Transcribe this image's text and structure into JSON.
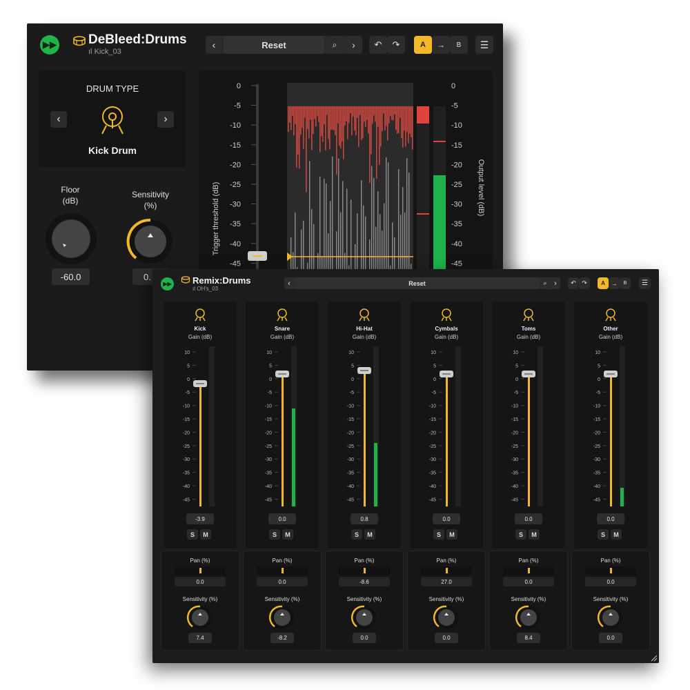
{
  "debleed": {
    "title": "DeBleed:Drums",
    "preset_sub": "Kick_03",
    "preset_name": "Reset",
    "ab": {
      "a": "A",
      "arrow": "→",
      "b": "B"
    },
    "drum_type_label": "DRUM TYPE",
    "drum_name": "Kick Drum",
    "floor_label_1": "Floor",
    "floor_label_2": "(dB)",
    "floor_value": "-60.0",
    "sens_label_1": "Sensitivity",
    "sens_label_2": "(%)",
    "sens_value": "0.",
    "left_axis_label": "Trigger threshold (dB)",
    "right_axis_label": "Output level (dB)",
    "left_ticks": [
      "0",
      "-5",
      "-10",
      "-15",
      "-20",
      "-25",
      "-30",
      "-35",
      "-40",
      "-45"
    ],
    "right_ticks": [
      "0",
      "-5",
      "-10",
      "-15",
      "-20",
      "-25",
      "-30",
      "-35",
      "-40",
      "-45"
    ]
  },
  "remix": {
    "title": "Remix:Drums",
    "preset_sub": "OH's_03",
    "preset_name": "Reset",
    "ab": {
      "a": "A",
      "arrow": "→",
      "b": "B"
    },
    "fader_ticks": [
      "10",
      "5",
      "0",
      "-5",
      "-10",
      "-15",
      "-20",
      "-25",
      "-30",
      "-35",
      "-40",
      "-45"
    ],
    "gain_unit": "Gain (dB)",
    "pan_label": "Pan (%)",
    "sens_label": "Sensitivity (%)",
    "solo": "S",
    "mute": "M",
    "channels": [
      {
        "name": "Kick",
        "gain": "-3.9",
        "pan": "0.0",
        "sensitivity": "7.4",
        "icon": "kick-drum-icon"
      },
      {
        "name": "Snare",
        "gain": "0.0",
        "pan": "0.0",
        "sensitivity": "-8.2",
        "icon": "snare-drum-icon"
      },
      {
        "name": "Hi-Hat",
        "gain": "0.8",
        "pan": "-8.6",
        "sensitivity": "0.0",
        "icon": "hi-hat-icon"
      },
      {
        "name": "Cymbals",
        "gain": "0.0",
        "pan": "27.0",
        "sensitivity": "0.0",
        "icon": "cymbal-icon"
      },
      {
        "name": "Toms",
        "gain": "0.0",
        "pan": "0.0",
        "sensitivity": "8.4",
        "icon": "tom-drum-icon"
      },
      {
        "name": "Other",
        "gain": "0.0",
        "pan": "0.0",
        "sensitivity": "0.0",
        "icon": "percussion-icon"
      }
    ]
  },
  "colors": {
    "accent": "#f2b82a",
    "play": "#22b34a",
    "meter_green": "#1fb24a",
    "meter_red": "#c8463f"
  }
}
